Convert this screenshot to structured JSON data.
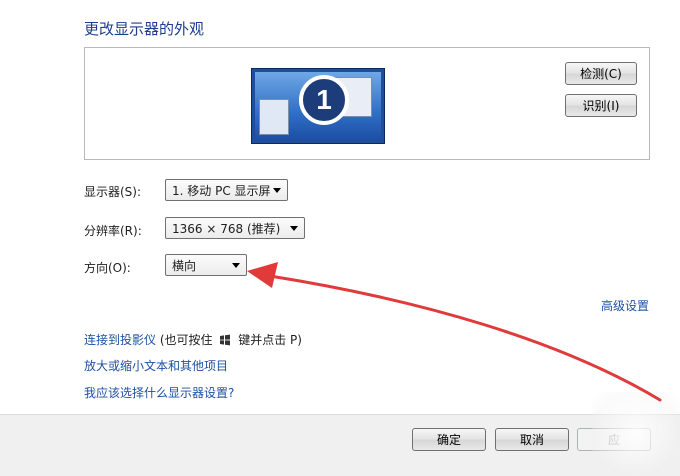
{
  "title": "更改显示器的外观",
  "preview": {
    "monitor_number": "1",
    "detect_label": "检测(C)",
    "identify_label": "识别(I)"
  },
  "settings": {
    "display_label": "显示器(S):",
    "display_value": "1. 移动 PC 显示屏",
    "resolution_label": "分辨率(R):",
    "resolution_value": "1366 × 768 (推荐)",
    "orientation_label": "方向(O):",
    "orientation_value": "横向"
  },
  "advanced_link": "高级设置",
  "links": {
    "projector": "连接到投影仪",
    "projector_hint_pre": "(也可按住",
    "projector_hint_post": "键并点击 P)",
    "text_size": "放大或缩小文本和其他项目",
    "which_setting": "我应该选择什么显示器设置?"
  },
  "footer": {
    "ok_label": "确定",
    "cancel_label": "取消",
    "apply_label": "应"
  },
  "annotation": {
    "arrow_color": "#e03a3a"
  }
}
